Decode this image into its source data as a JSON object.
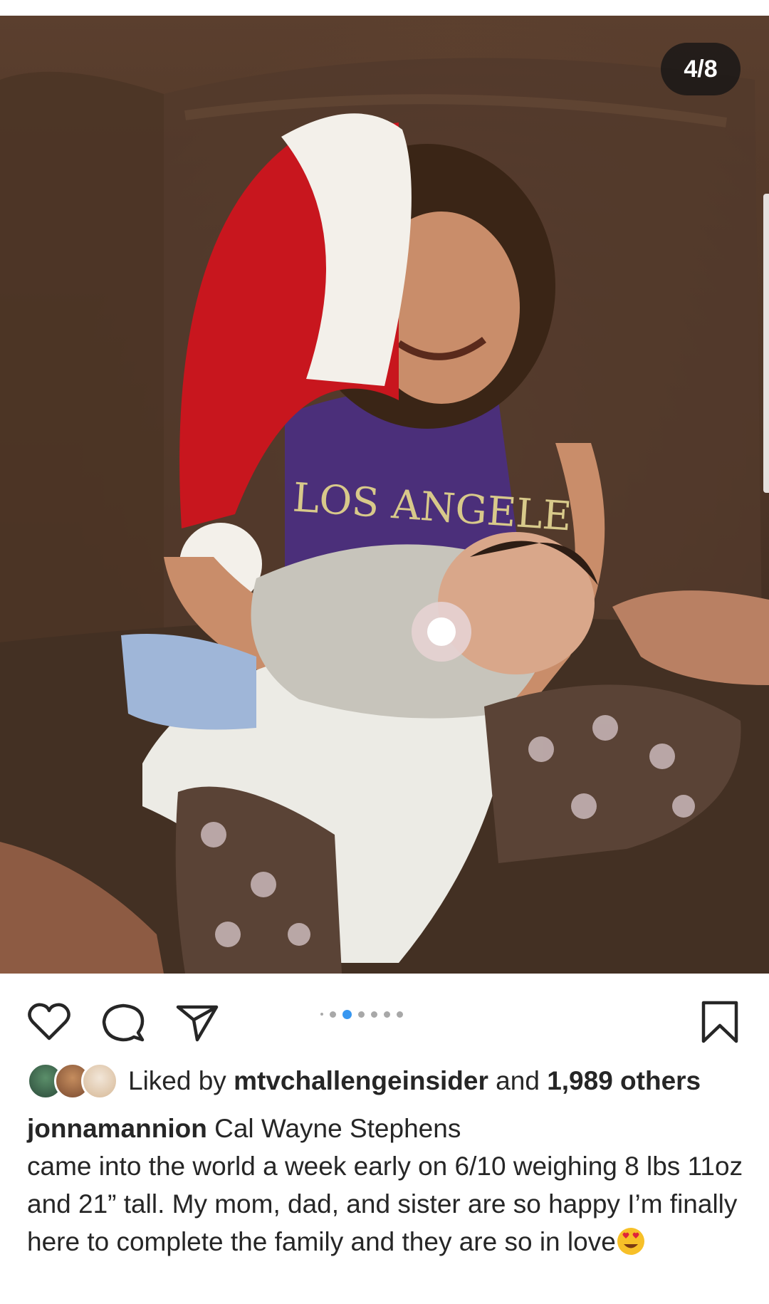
{
  "post": {
    "image_counter": "4/8",
    "carousel": {
      "dot_count": 7,
      "active_index": 2
    }
  },
  "actions": {
    "like_icon": "heart-icon",
    "comment_icon": "comment-icon",
    "share_icon": "paper-plane-icon",
    "save_icon": "bookmark-icon"
  },
  "likes": {
    "prefix": "Liked by",
    "user": "mtvchallengeinsider",
    "conjunction": "and",
    "others": "1,989 others"
  },
  "caption": {
    "username": "jonnamannion",
    "text": "Cal Wayne Stephens\ncame into the world a week early on 6/10 weighing 8 lbs 11oz and 21” tall. My mom, dad, and sister are so happy I’m finally here to complete the family and they are so in love",
    "emoji": "heart-eyes-emoji"
  },
  "colors": {
    "active_dot": "#3897f0",
    "inactive_dot": "#a8a8a8",
    "text": "#262626"
  }
}
